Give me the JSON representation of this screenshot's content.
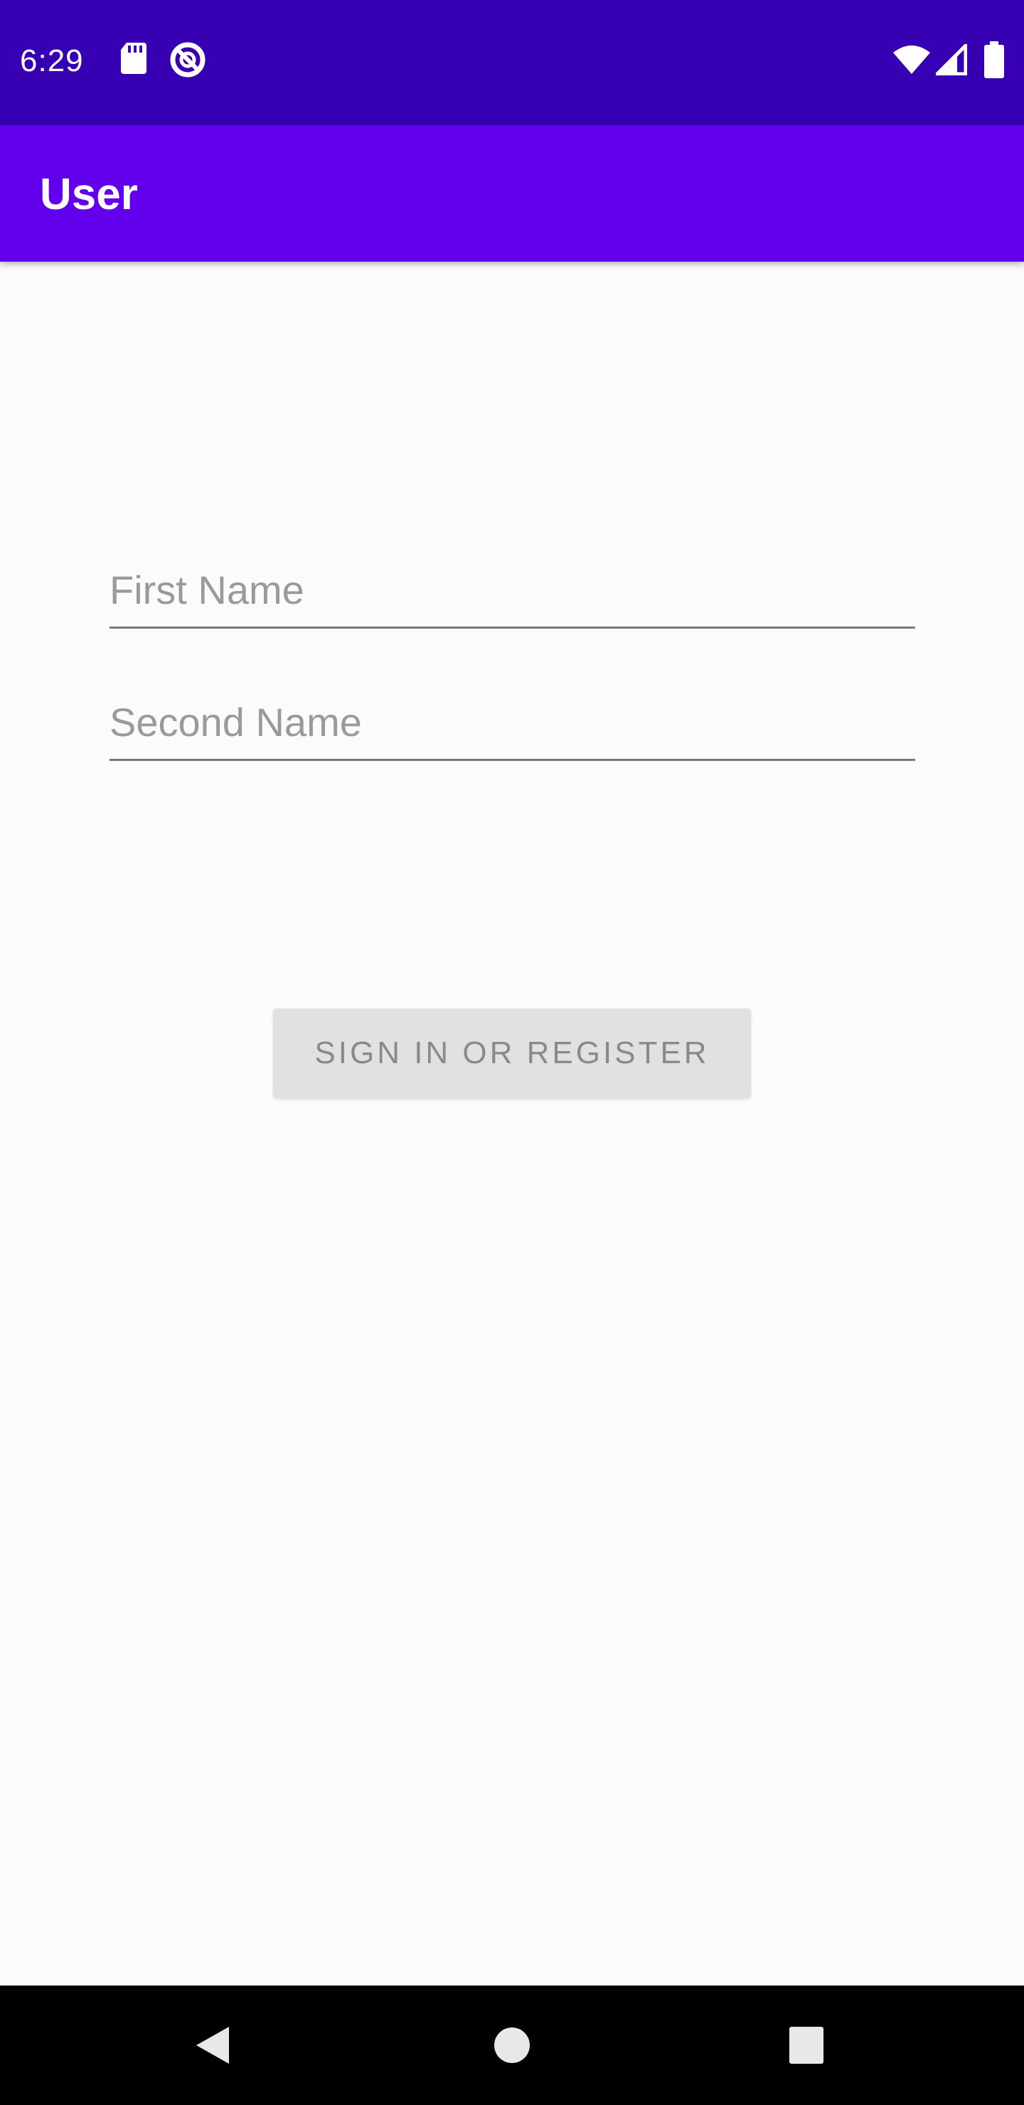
{
  "status_bar": {
    "time": "6:29",
    "icons_left": [
      "sd-card-icon",
      "do-not-disturb-icon"
    ],
    "icons_right": [
      "wifi-icon",
      "signal-icon",
      "battery-icon"
    ],
    "background": "#3700b3"
  },
  "app_bar": {
    "title": "User",
    "background": "#6200ee"
  },
  "form": {
    "first_name": {
      "placeholder": "First Name",
      "value": ""
    },
    "second_name": {
      "placeholder": "Second Name",
      "value": ""
    },
    "submit_label": "SIGN IN OR REGISTER"
  },
  "nav_bar": {
    "buttons": [
      "back-icon",
      "home-icon",
      "recents-icon"
    ]
  }
}
